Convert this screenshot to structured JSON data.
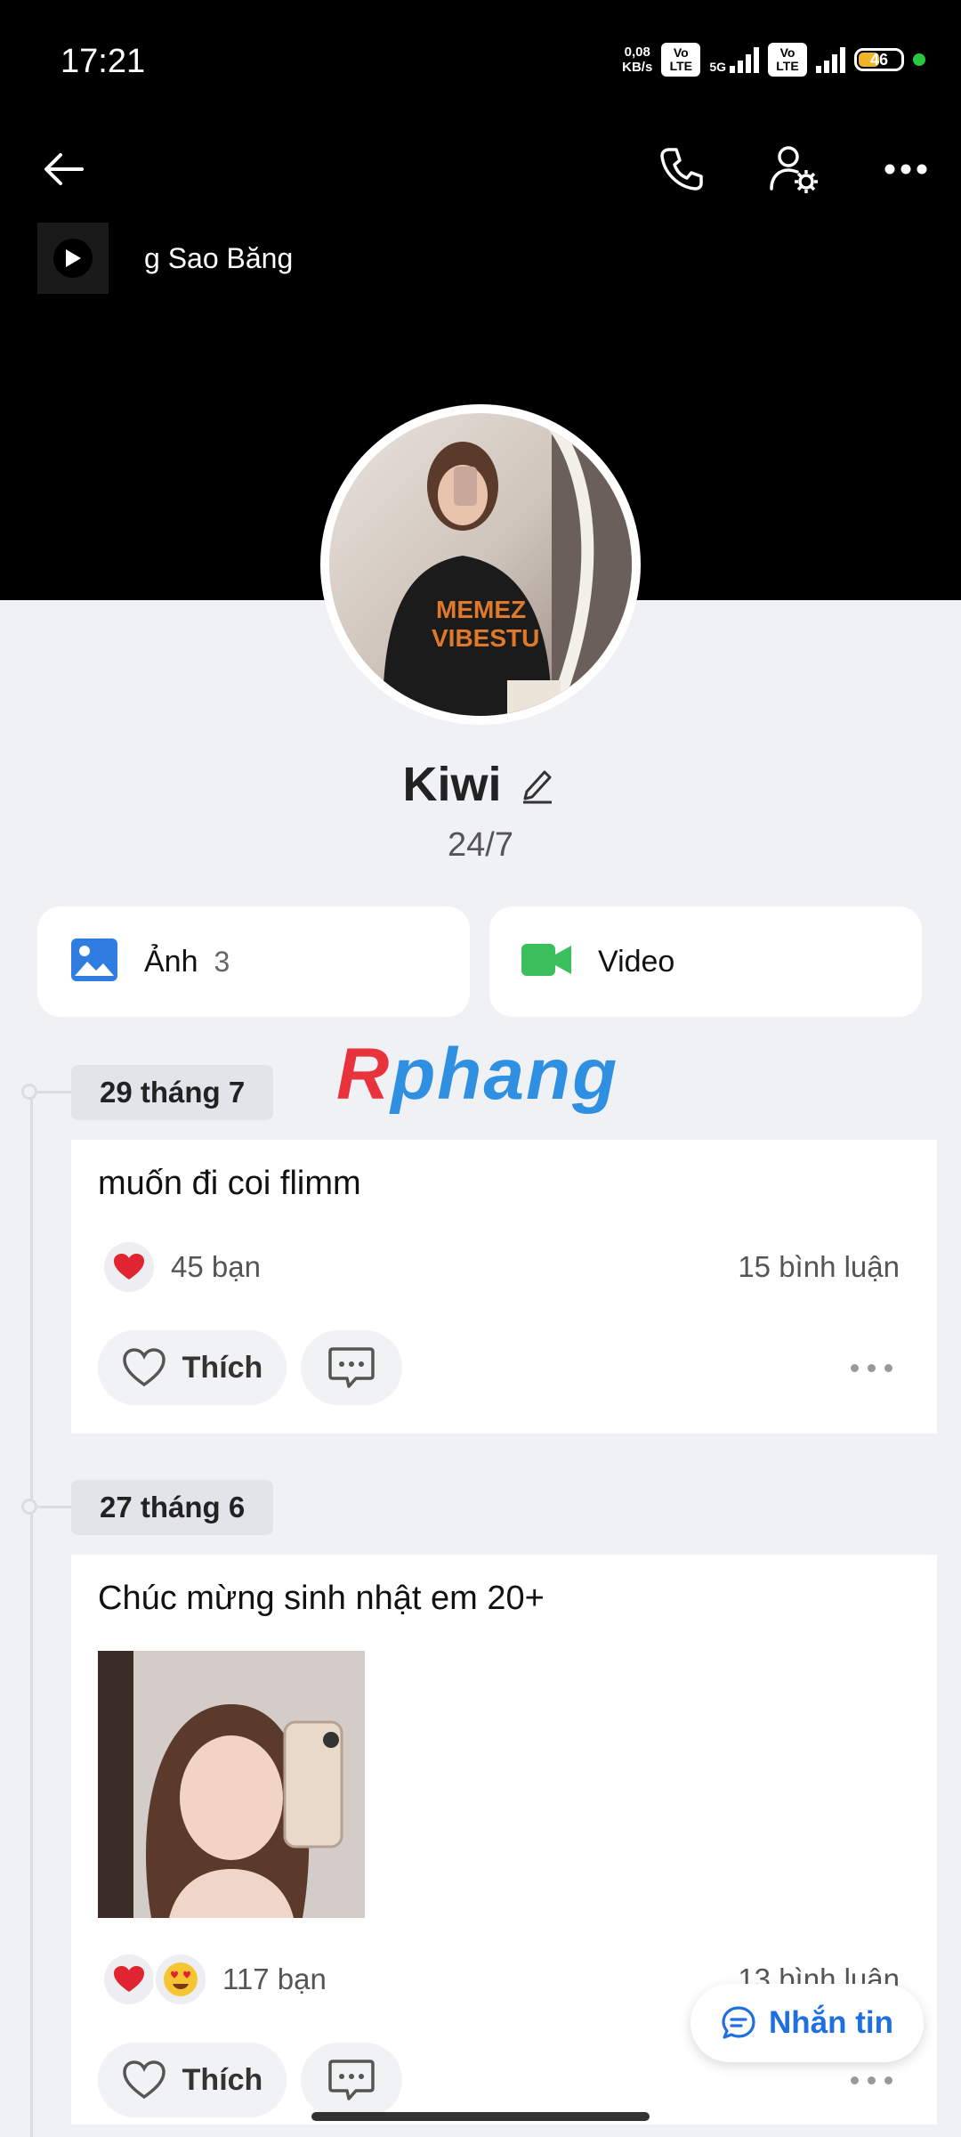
{
  "status": {
    "time": "17:21",
    "netspeed_top": "0,08",
    "netspeed_bottom": "KB/s",
    "lte1": "Vo LTE",
    "net": "5G",
    "lte2": "Vo LTE",
    "battery": "46"
  },
  "music": {
    "song": "g Sao Băng"
  },
  "profile": {
    "name": "Kiwi",
    "bio": "24/7"
  },
  "media": {
    "photos_label": "Ảnh",
    "photos_count": "3",
    "video_label": "Video"
  },
  "watermark": {
    "r": "R",
    "rest": "phang"
  },
  "posts": [
    {
      "date": "29 tháng 7",
      "text": "muốn đi coi flimm",
      "reactions": "45 bạn",
      "comments": "15 bình luận",
      "like_label": "Thích"
    },
    {
      "date": "27 tháng 6",
      "text": "Chúc mừng sinh nhật em 20+",
      "reactions": "117 bạn",
      "comments": "13 bình luận",
      "like_label": "Thích"
    }
  ],
  "message_button": "Nhắn tin",
  "colors": {
    "header": "#000000",
    "accent": "#1f6fe0",
    "background": "#eff1f4"
  }
}
